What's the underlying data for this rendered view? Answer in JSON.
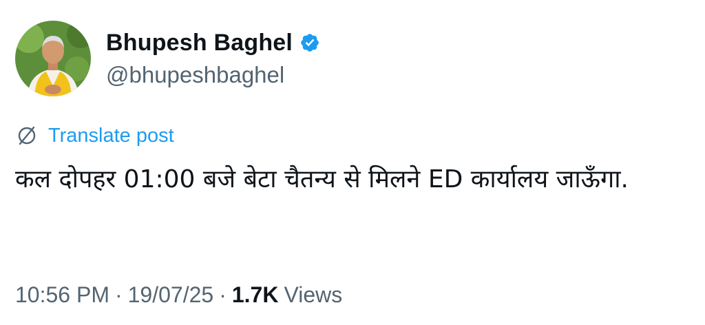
{
  "author": {
    "display_name": "Bhupesh Baghel",
    "handle": "@bhupeshbaghel",
    "verified_icon": "verified-badge-icon",
    "avatar": "profile-photo"
  },
  "translate": {
    "icon": "globe-translate-icon",
    "label": "Translate post"
  },
  "post": {
    "text": "कल दोपहर 01:00 बजे बेटा चैतन्य से मिलने ED कार्यालय जाऊँगा."
  },
  "meta": {
    "time": "10:56 PM",
    "separator": "·",
    "date": "19/07/25",
    "views_count": "1.7K",
    "views_label": "Views"
  },
  "colors": {
    "accent": "#1d9bf0",
    "secondary_text": "#536471",
    "primary_text": "#0f1419"
  }
}
